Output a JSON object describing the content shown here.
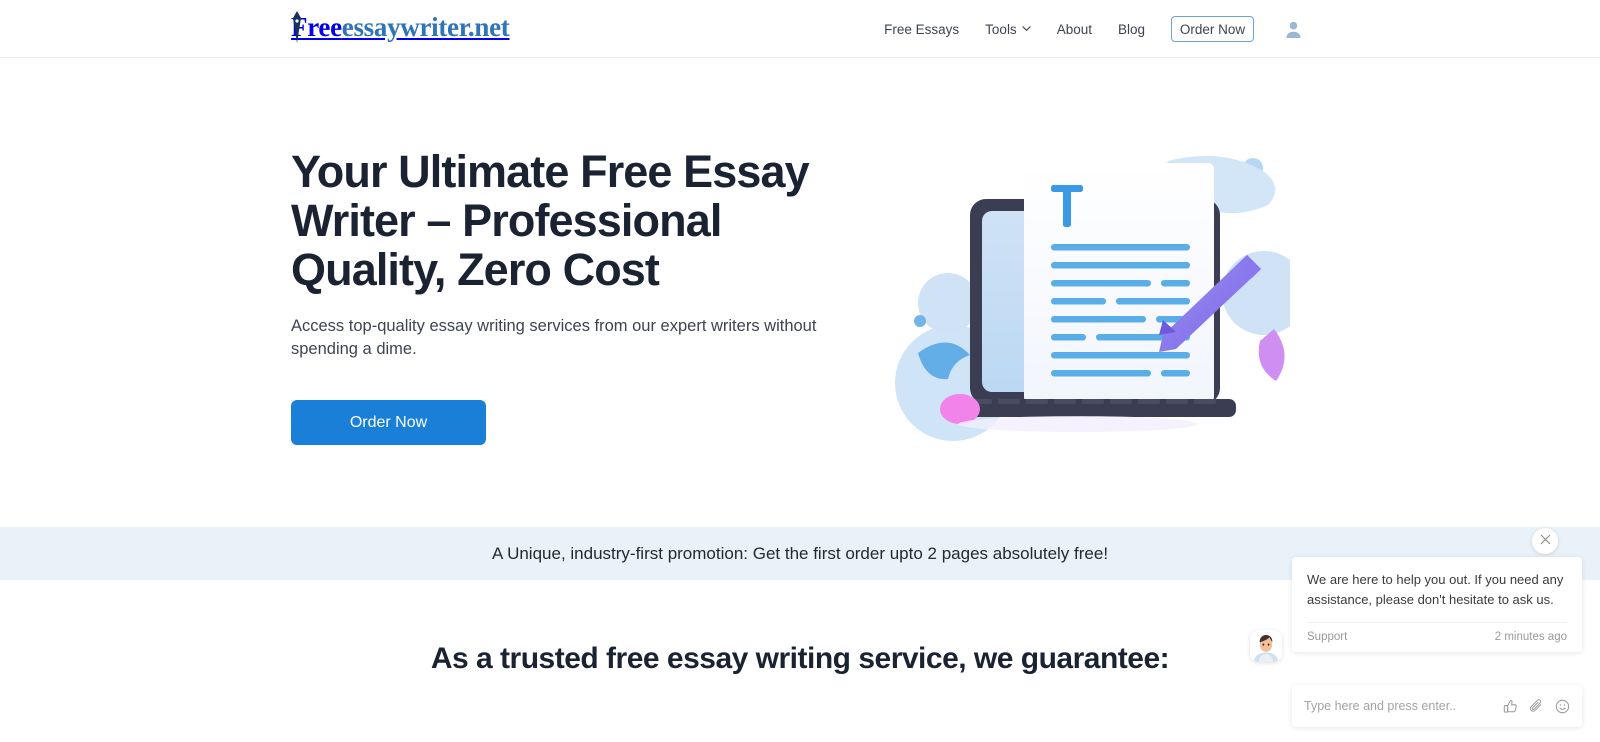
{
  "header": {
    "logo": {
      "part1": "Free",
      "part2": "essaywriter.net"
    },
    "nav": [
      {
        "label": "Free Essays",
        "name": "nav-free-essays",
        "dropdown": false
      },
      {
        "label": "Tools",
        "name": "nav-tools",
        "dropdown": true
      },
      {
        "label": "About",
        "name": "nav-about",
        "dropdown": false
      },
      {
        "label": "Blog",
        "name": "nav-blog",
        "dropdown": false
      }
    ],
    "order_button": "Order Now",
    "account_icon": "user-avatar-icon"
  },
  "hero": {
    "headline": "Your Ultimate Free Essay Writer – Professional Quality, Zero Cost",
    "subtext": "Access top-quality essay writing services from our expert writers without spending a dime.",
    "cta": "Order Now",
    "illustration": "laptop-document-pen-illustration"
  },
  "promo": {
    "text": "A Unique, industry-first promotion: Get the first order upto 2 pages absolutely free!"
  },
  "guarantee": {
    "heading": "As a trusted free essay writing service, we guarantee:"
  },
  "chat": {
    "close_icon": "close-icon",
    "message": "We are here to help you out. If you need any assistance, please don't hesitate to ask us.",
    "sender": "Support",
    "timestamp": "2 minutes ago",
    "input_placeholder": "Type here and press enter..",
    "icons": [
      "thumbs-up-icon",
      "paperclip-icon",
      "smiley-icon"
    ],
    "agent_avatar": "support-agent-avatar"
  },
  "colors": {
    "accent_blue": "#1a7fd6",
    "nav_link_blue": "#3186d6",
    "headline_navy": "#1b2333",
    "promo_band": "#e9f1f9",
    "logo_dark": "#17315c",
    "logo_light": "#2f74ba"
  }
}
